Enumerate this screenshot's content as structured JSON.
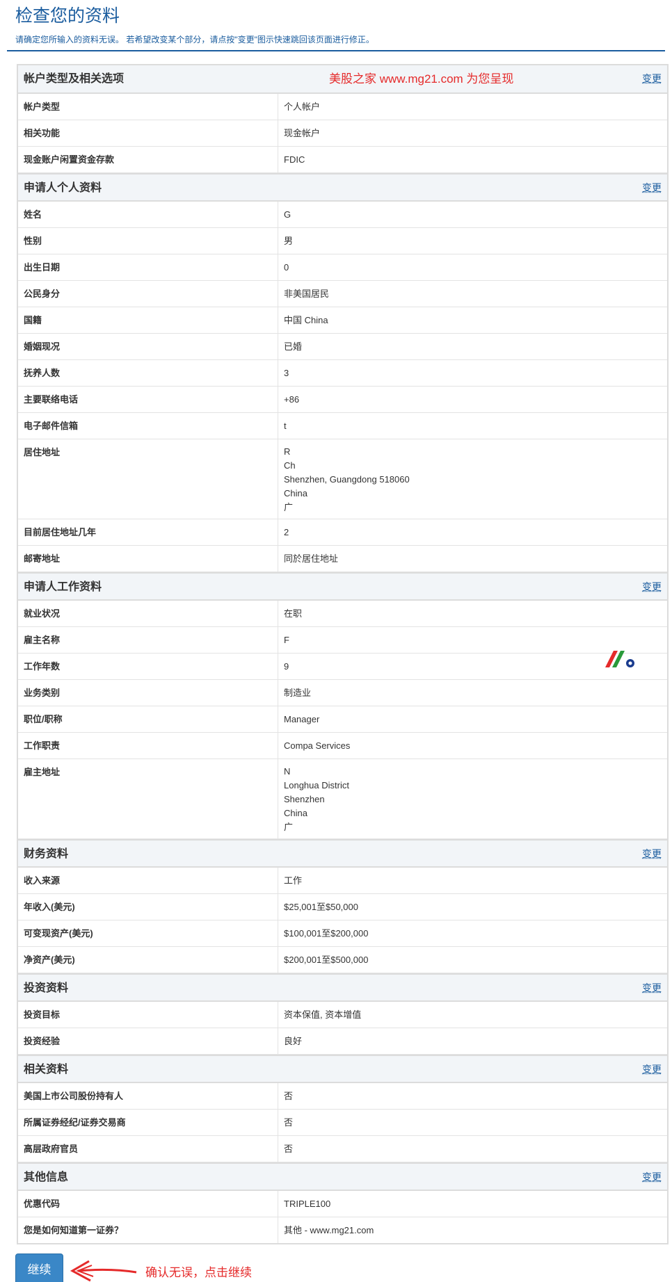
{
  "header": {
    "title": "检查您的资料",
    "subtitle": "请确定您所输入的资料无误。 若希望改变某个部分，请点按\"变更\"图示快速跳回该页面进行修正。"
  },
  "change_label": "变更",
  "watermark": "美股之家 www.mg21.com 为您呈现",
  "sections": [
    {
      "title": "帐户类型及相关选项",
      "rows": [
        {
          "label": "帐户类型",
          "value": "个人帐户"
        },
        {
          "label": "相关功能",
          "value": "现金帐户"
        },
        {
          "label": "现金账户闲置资金存款",
          "value": "FDIC"
        }
      ]
    },
    {
      "title": "申请人个人资料",
      "rows": [
        {
          "label": "姓名",
          "value": "G"
        },
        {
          "label": "性别",
          "value": "男"
        },
        {
          "label": "出生日期",
          "value": "0"
        },
        {
          "label": "公民身分",
          "value": "非美国居民"
        },
        {
          "label": "国籍",
          "value": "中国 China"
        },
        {
          "label": "婚姻现况",
          "value": "已婚"
        },
        {
          "label": "抚养人数",
          "value": "3"
        },
        {
          "label": "主要联络电话",
          "value": "+86"
        },
        {
          "label": "电子邮件信箱",
          "value": "t"
        },
        {
          "label": "居住地址",
          "lines": [
            "R",
            "Ch",
            "Shenzhen, Guangdong 518060",
            "China",
            "广"
          ]
        },
        {
          "label": "目前居住地址几年",
          "value": "2"
        },
        {
          "label": "邮寄地址",
          "value": "同於居住地址"
        }
      ]
    },
    {
      "title": "申请人工作资料",
      "rows": [
        {
          "label": "就业状况",
          "value": "在职"
        },
        {
          "label": "雇主名称",
          "value": "F"
        },
        {
          "label": "工作年数",
          "value": "9"
        },
        {
          "label": "业务类别",
          "value": "制造业"
        },
        {
          "label": "职位/职称",
          "value": "Manager"
        },
        {
          "label": "工作职责",
          "value": "Compa Services"
        },
        {
          "label": "雇主地址",
          "lines": [
            "N",
            "Longhua District",
            "Shenzhen",
            "China",
            "广"
          ]
        }
      ]
    },
    {
      "title": "财务资料",
      "rows": [
        {
          "label": "收入来源",
          "value": "工作"
        },
        {
          "label": "年收入(美元)",
          "value": "$25,001至$50,000"
        },
        {
          "label": "可变现资产(美元)",
          "value": "$100,001至$200,000"
        },
        {
          "label": "净资产(美元)",
          "value": "$200,001至$500,000"
        }
      ]
    },
    {
      "title": "投资资料",
      "rows": [
        {
          "label": "投资目标",
          "value": "资本保值, 资本增值"
        },
        {
          "label": "投资经验",
          "value": "良好"
        }
      ]
    },
    {
      "title": "相关资料",
      "rows": [
        {
          "label": "美国上市公司股份持有人",
          "value": "否"
        },
        {
          "label": "所属证券经纪/证券交易商",
          "value": "否"
        },
        {
          "label": "高层政府官员",
          "value": "否"
        }
      ]
    },
    {
      "title": "其他信息",
      "rows": [
        {
          "label": "优惠代码",
          "value": "TRIPLE100"
        },
        {
          "label": "您是如何知道第一证券？",
          "value": "其他 - www.mg21.com"
        }
      ]
    }
  ],
  "footer": {
    "continue_label": "继续",
    "note": "确认无误，点击继续"
  },
  "colors": {
    "brand_blue": "#1a5c9e",
    "annotation_red": "#e52a2a",
    "button_blue": "#3a87c7"
  },
  "icons": [
    "arrow-left-icon",
    "logo-icon"
  ]
}
